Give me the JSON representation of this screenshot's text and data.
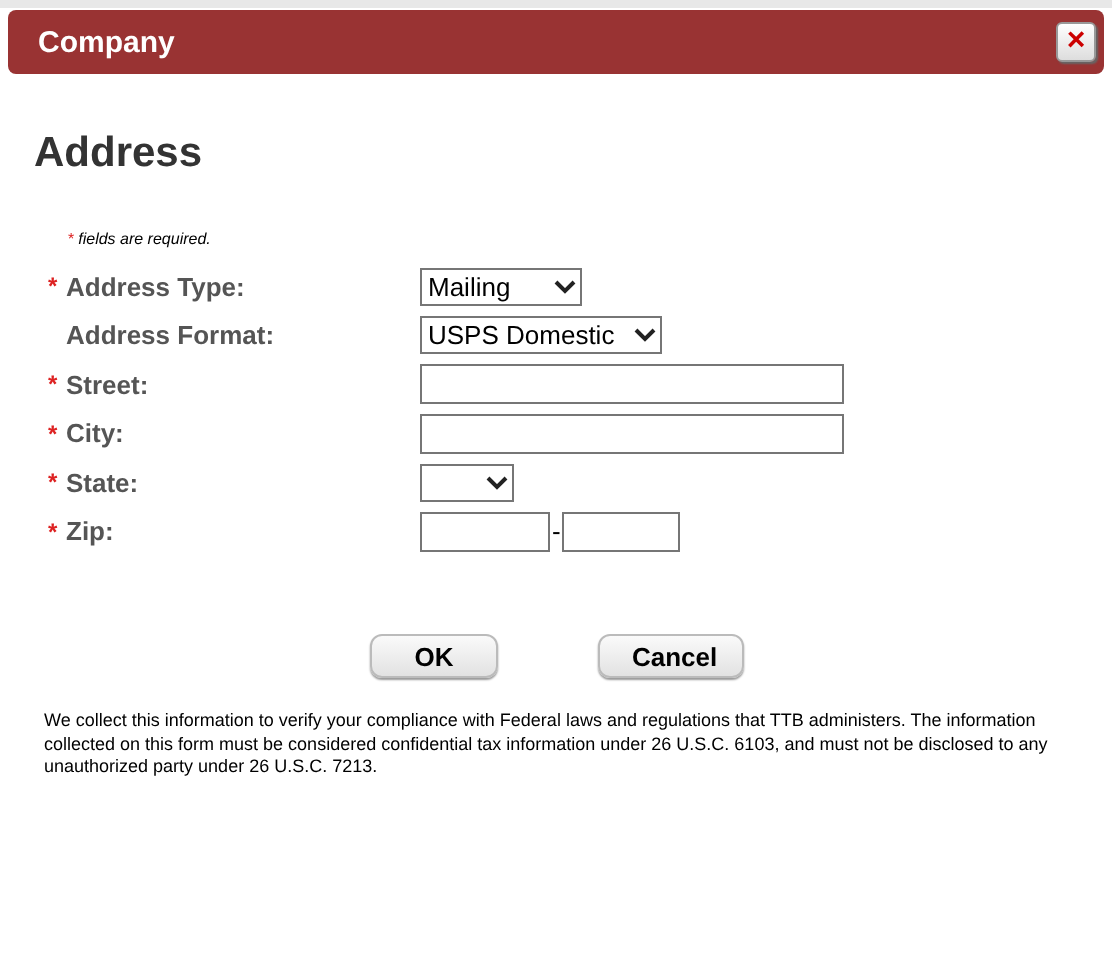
{
  "window": {
    "title": "Company",
    "close_label": "×"
  },
  "heading": "Address",
  "note": {
    "mark": "*",
    "text": "fields are required."
  },
  "fields": [
    {
      "label": "Address Type:",
      "mark": "*",
      "kind": "select",
      "value": "Mailing"
    },
    {
      "label": "Address Format:",
      "kind": "select",
      "value": "USPS Domestic"
    },
    {
      "label": "Street:",
      "mark": "*",
      "kind": "text"
    },
    {
      "label": "City:",
      "mark": "*",
      "kind": "text"
    },
    {
      "label": "State:",
      "mark": "*",
      "kind": "select"
    },
    {
      "label": "Zip:",
      "mark": "*",
      "kind": "zip",
      "separator": "-"
    }
  ],
  "buttons": [
    "OK",
    "Cancel"
  ],
  "disclaimer": "We collect this information to verify your compliance with Federal laws and regulations that TTB administers. The information collected on this form must be considered confidential tax information under 26 U.S.C. 6103, and must not be disclosed to any unauthorized party under 26 U.S.C. 7213."
}
